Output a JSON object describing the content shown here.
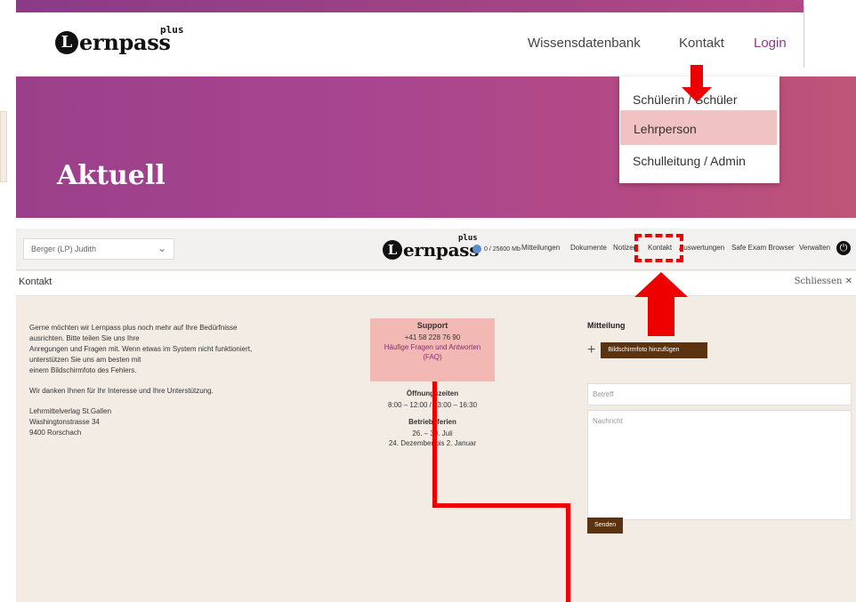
{
  "header": {
    "logo_text": "ernpass",
    "logo_initial": "L",
    "logo_plus": "plus",
    "nav": [
      "Wissensdatenbank",
      "Kontakt",
      "Login"
    ],
    "colors": {
      "login": "#8a3b86",
      "hero_start": "#9b3f8a",
      "hero_end": "#bf5577"
    }
  },
  "dropdown": {
    "items": [
      "Schülerin / Schüler",
      "Lehrperson",
      "Schulleitung / Admin"
    ],
    "highlighted_index": 1
  },
  "hero": {
    "title": "Aktuell"
  },
  "app": {
    "user": "Berger (LP) Judith",
    "storage": "0 / 25600 Mb",
    "menu": [
      "Mitteilungen",
      "Dokumente",
      "Notizen",
      "Kontakt",
      "Auswertungen",
      "Safe Exam Browser",
      "Verwalten"
    ],
    "accent_color": "#5b3310"
  },
  "contact": {
    "title": "Kontakt",
    "close_label": "Schliessen",
    "intro_lines": [
      "Gerne möchten wir Lernpass plus noch mehr auf Ihre Bedürfnisse",
      "ausrichten. Bitte teilen Sie uns Ihre",
      "Anregungen und Fragen mit. Wenn etwas im System nicht funktioniert,",
      "unterstützen Sie uns am besten mit",
      "einem Bildschirmfoto des Fehlers."
    ],
    "thanks": "Wir danken Ihnen für Ihr Interesse und Ihre Unterstützung.",
    "address": [
      "Lehrmittelverlag St.Gallen",
      "Washingtonstrasse 34",
      "9400 Rorschach"
    ],
    "support": {
      "heading": "Support",
      "phone": "+41 58 228 76 90",
      "faq_line1": "Häufige Fragen und Antworten",
      "faq_line2": "(FAQ)",
      "hours_heading": "Öffnungszeiten",
      "hours": "8:00 – 12:00 / 13:00 – 16:30",
      "holidays_heading": "Betriebsferien",
      "holidays_1": "26. – 30. Juli",
      "holidays_2": "24. Dezember bis 2. Januar"
    },
    "message": {
      "heading": "Mitteilung",
      "attach_label": "Bildschirmfoto hinzufügen",
      "subject_placeholder": "Betreff",
      "message_placeholder": "Nachricht",
      "send_label": "Senden"
    }
  }
}
